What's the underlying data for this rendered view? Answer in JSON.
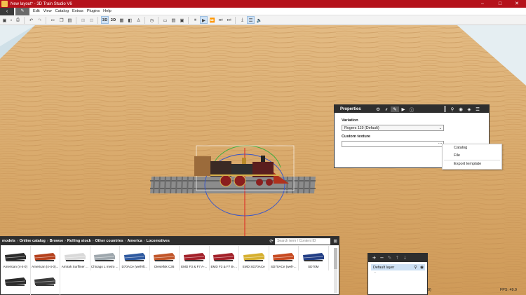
{
  "window": {
    "title": "New layout* - 3D Train Studio V6"
  },
  "menubar": {
    "items": [
      "Edit",
      "View",
      "Catalog",
      "Extras",
      "Plugins",
      "Help"
    ]
  },
  "toolbar": {
    "mode_3d": "3D",
    "mode_2d": "2D"
  },
  "properties": {
    "title": "Properties",
    "variation_label": "Variation",
    "variation_value": "Rogers 119 (Default)",
    "custom_texture_label": "Custom texture",
    "browse_button": "...",
    "menu_items": [
      "Catalog",
      "File",
      "Export template"
    ]
  },
  "catalog": {
    "breadcrumb": [
      "models",
      "Online catalog",
      "Browse",
      "Rolling stock",
      "Other countries",
      "America",
      "Locomotives"
    ],
    "search_placeholder": "Search term / Content ID",
    "items": [
      {
        "label": "American (4-4-0)",
        "color": "#2b2b2b"
      },
      {
        "label": "American (4-4-0)...",
        "color": "#b5411d"
      },
      {
        "label": "Amtrak Surfliner ...",
        "color": "#d9d9d9"
      },
      {
        "label": "Chicago L metro ...",
        "color": "#9ea7ad"
      },
      {
        "label": "D70ACe (well-ill...",
        "color": "#2f5aa0"
      },
      {
        "label": "Diesellok C36",
        "color": "#c1562a"
      },
      {
        "label": "EMD F3 & F7 A-...",
        "color": "#a3212a"
      },
      {
        "label": "EMD F3 & F7 B-...",
        "color": "#a3212a"
      },
      {
        "label": "EMD SD70ACe",
        "color": "#d6b030"
      },
      {
        "label": "SD70ACe (well-...",
        "color": "#c74b22"
      },
      {
        "label": "SD70M",
        "color": "#233f86"
      },
      {
        "label": "",
        "color": "#2a2a2a"
      },
      {
        "label": "",
        "color": "#3b3b3b"
      }
    ]
  },
  "layers": {
    "default_layer": "Default layer",
    "sub": "-"
  },
  "status": {
    "left_fragment": "0)",
    "fps": "FPS: 49.9"
  }
}
